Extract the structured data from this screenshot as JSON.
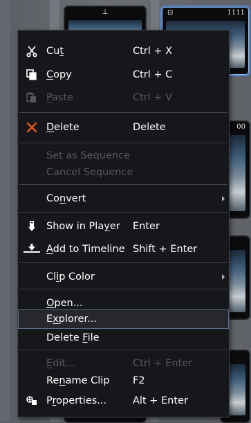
{
  "background": {
    "tile_top_left_mark": "⊥",
    "tile_top_right_mark": "⊟",
    "tile_top_right_number": "1111",
    "tile_mid_right_number": "00"
  },
  "menu": {
    "cut": {
      "label_pre": "Cu",
      "label_u": "t",
      "label_post": "",
      "shortcut": "Ctrl + X",
      "icon": "scissors-icon"
    },
    "copy": {
      "label_pre": "",
      "label_u": "C",
      "label_post": "opy",
      "shortcut": "Ctrl + C",
      "icon": "copy-icon"
    },
    "paste": {
      "label_pre": "",
      "label_u": "P",
      "label_post": "aste",
      "shortcut": "Ctrl + V",
      "icon": "paste-icon"
    },
    "delete": {
      "label_pre": "",
      "label_u": "D",
      "label_post": "elete",
      "shortcut": "Delete",
      "icon": "delete-x-icon",
      "icon_color": "#e0531c"
    },
    "set_sequence": {
      "label": "Set as Sequence"
    },
    "cancel_sequence": {
      "label": "Cancel Sequence"
    },
    "convert": {
      "label_pre": "Co",
      "label_u": "n",
      "label_post": "vert"
    },
    "show_in_player": {
      "label_pre": "Show in Pla",
      "label_u": "y",
      "label_post": "er",
      "shortcut": "Enter",
      "icon": "player-icon"
    },
    "add_to_timeline": {
      "label_pre": "",
      "label_u": "A",
      "label_post": "dd to Timeline",
      "shortcut": "Shift + Enter",
      "icon": "timeline-icon"
    },
    "clip_color": {
      "label_pre": "Cl",
      "label_u": "i",
      "label_post": "p Color"
    },
    "open": {
      "label_pre": "",
      "label_u": "O",
      "label_post": "pen..."
    },
    "explorer": {
      "label_pre": "E",
      "label_u": "x",
      "label_post": "plorer..."
    },
    "delete_file": {
      "label_pre": "Delete ",
      "label_u": "F",
      "label_post": "ile"
    },
    "edit": {
      "label_pre": "",
      "label_u": "E",
      "label_post": "dit...",
      "shortcut": "Ctrl + Enter"
    },
    "rename_clip": {
      "label_pre": "Re",
      "label_u": "n",
      "label_post": "ame Clip",
      "shortcut": "F2"
    },
    "properties": {
      "label_pre": "P",
      "label_u": "r",
      "label_post": "operties...",
      "shortcut": "Alt + Enter",
      "icon": "properties-icon"
    }
  },
  "colors": {
    "menu_bg": "#16171a",
    "disabled_text": "#56585d",
    "hover_border": "#5b6b86",
    "selection_border": "#4e86d6"
  }
}
